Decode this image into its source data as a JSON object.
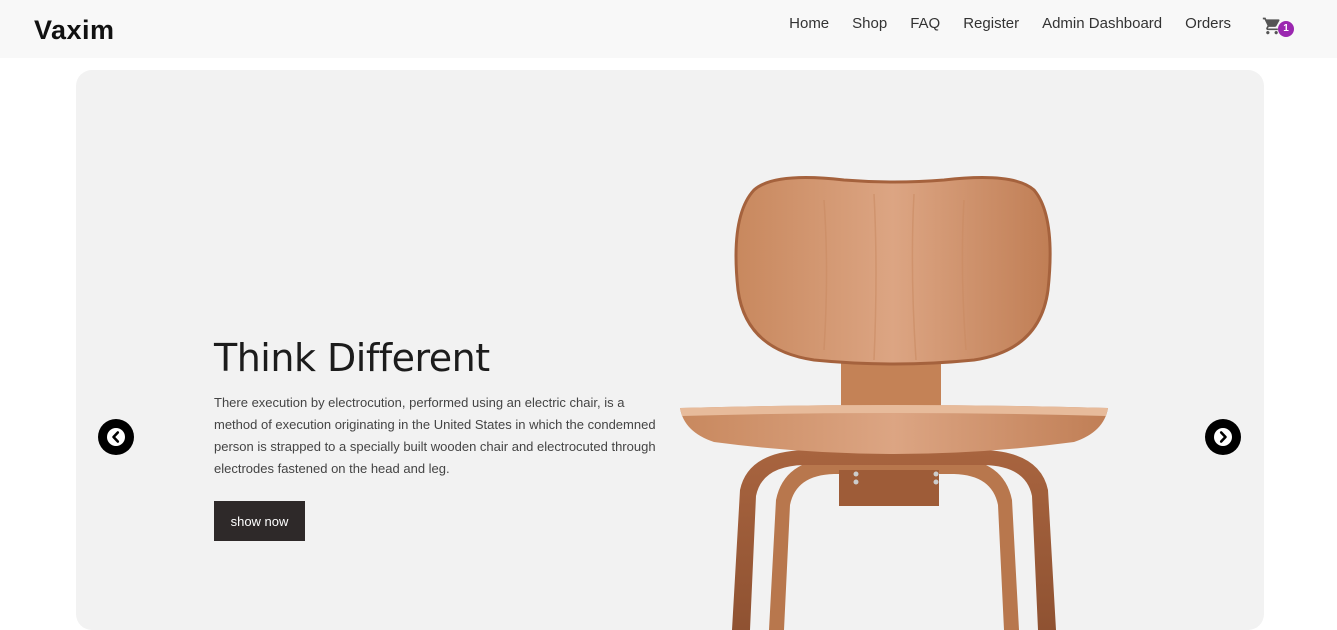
{
  "navbar": {
    "brand": "Vaxim",
    "links": [
      {
        "label": "Home"
      },
      {
        "label": "Shop"
      },
      {
        "label": "FAQ"
      },
      {
        "label": "Register"
      },
      {
        "label": "Admin Dashboard"
      },
      {
        "label": "Orders"
      }
    ],
    "cart": {
      "icon": "shopping-cart-icon",
      "count": "1"
    }
  },
  "hero": {
    "title": "Think Different",
    "text": "There execution by electrocution, performed using an electric chair, is a method of execution originating in the United States in which the condemned person is strapped to a specially built wooden chair and electrocuted through electrodes fastened on the head and leg.",
    "button_label": "show now",
    "prev_icon": "chevron-left-circle-icon",
    "next_icon": "chevron-right-circle-icon",
    "image": "wooden-chair-image"
  },
  "colors": {
    "navbar_bg": "#f8f8f8",
    "hero_bg": "#f2f2f2",
    "button_bg": "#2e2929",
    "badge_bg": "#9b27b0",
    "arrow_bg": "#000000"
  }
}
